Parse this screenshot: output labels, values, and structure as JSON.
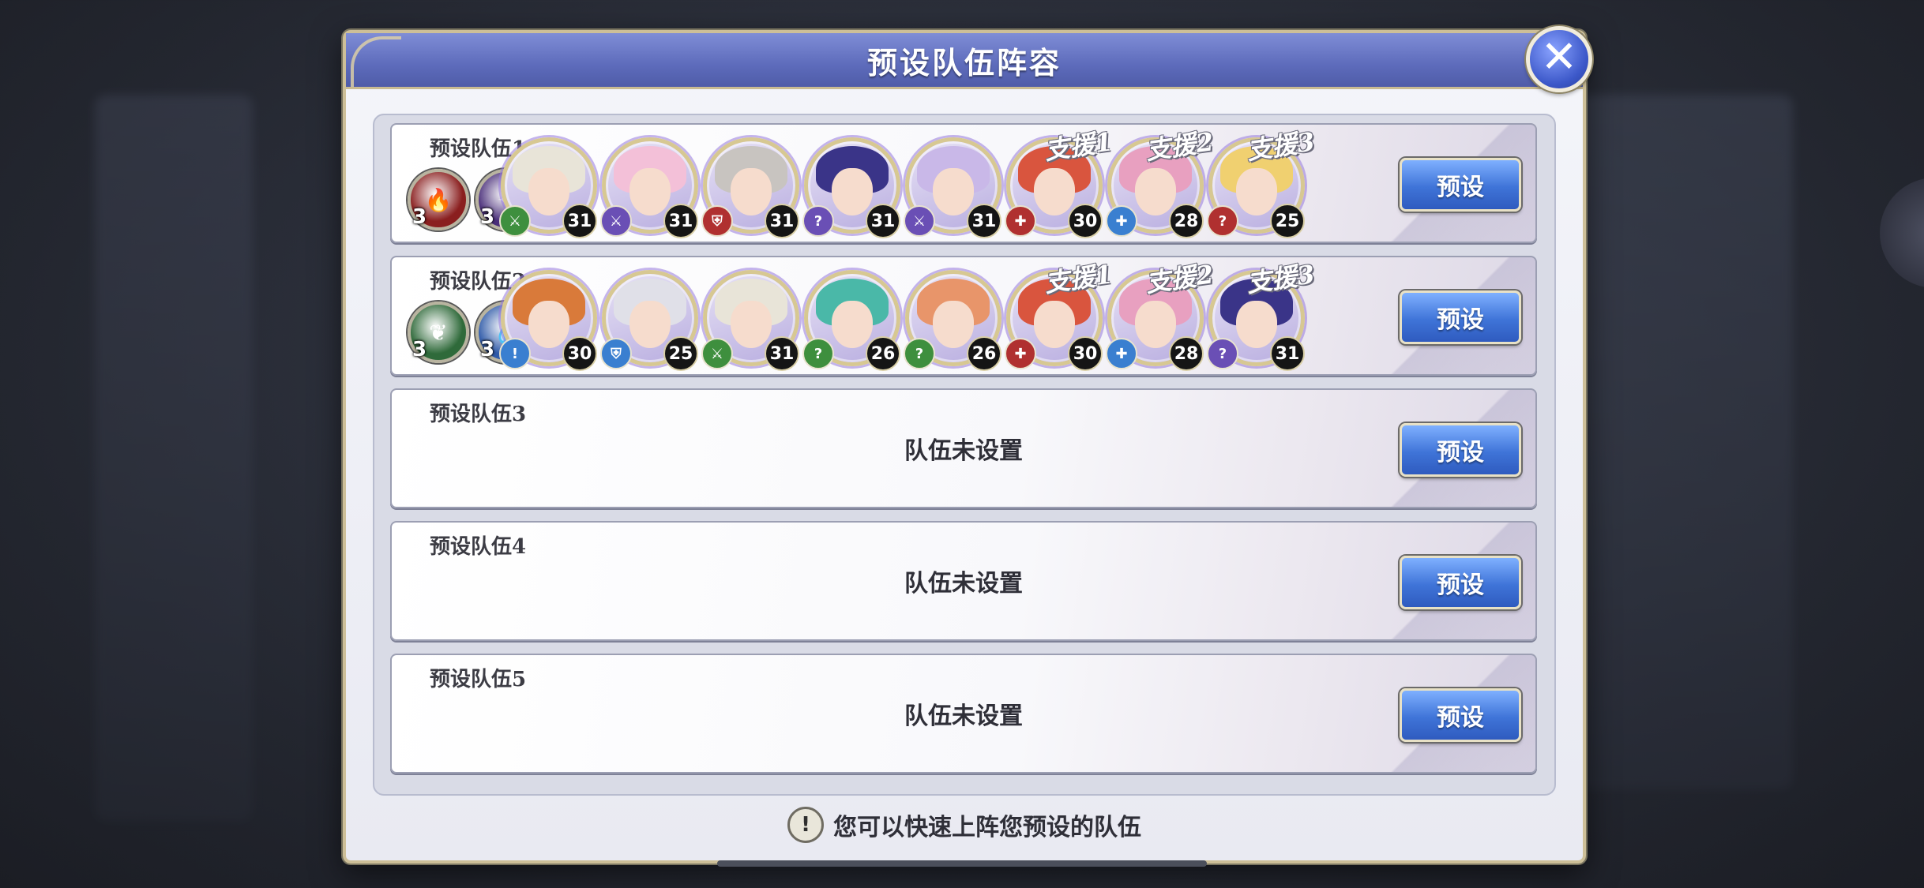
{
  "dialog": {
    "title": "预设队伍阵容",
    "tip": "您可以快速上阵您预设的队伍",
    "tip_icon": "!"
  },
  "close_icon": "✕",
  "colors": {
    "title_bar": "#5d6bbb",
    "button_blue": "#3f74d8",
    "frame_gold": "#cdbf98"
  },
  "teams": [
    {
      "label": "预设队伍1",
      "button": "预设",
      "elements": [
        {
          "icon": "fire-icon",
          "glyph": "🔥",
          "color": "#8a1f1f",
          "count": "3"
        },
        {
          "icon": "dark-icon",
          "glyph": "✦",
          "color": "#4a2f7a",
          "count": "3"
        }
      ],
      "members": [
        {
          "level": "31",
          "class": "sword",
          "class_glyph": "⚔",
          "class_color": "#3e8f3e",
          "hair": "#e8e4d8",
          "support": ""
        },
        {
          "level": "31",
          "class": "sword",
          "class_glyph": "⚔",
          "class_color": "#6a4fb5",
          "hair": "#f3c0d8",
          "support": ""
        },
        {
          "level": "31",
          "class": "shield",
          "class_glyph": "⛨",
          "class_color": "#b03030",
          "hair": "#c8c4c0",
          "support": ""
        },
        {
          "level": "31",
          "class": "mage",
          "class_glyph": "?",
          "class_color": "#6a4fb5",
          "hair": "#3a3488",
          "support": ""
        },
        {
          "level": "31",
          "class": "sword",
          "class_glyph": "⚔",
          "class_color": "#6a4fb5",
          "hair": "#c9b8e8",
          "support": ""
        },
        {
          "level": "30",
          "class": "healer",
          "class_glyph": "✚",
          "class_color": "#b03030",
          "hair": "#d9553e",
          "support": "支援1"
        },
        {
          "level": "28",
          "class": "healer",
          "class_glyph": "✚",
          "class_color": "#3a7fd0",
          "hair": "#e8a0c0",
          "support": "支援2"
        },
        {
          "level": "25",
          "class": "mage",
          "class_glyph": "?",
          "class_color": "#b03030",
          "hair": "#f0d070",
          "support": "支援3"
        }
      ]
    },
    {
      "label": "预设队伍2",
      "button": "预设",
      "elements": [
        {
          "icon": "wind-icon",
          "glyph": "❦",
          "color": "#2f6a3a",
          "count": "3"
        },
        {
          "icon": "water-icon",
          "glyph": "💧",
          "color": "#2f5aa8",
          "count": "3"
        }
      ],
      "members": [
        {
          "level": "30",
          "class": "lance",
          "class_glyph": "!",
          "class_color": "#3a7fd0",
          "hair": "#d97a3a",
          "support": ""
        },
        {
          "level": "25",
          "class": "shield",
          "class_glyph": "⛨",
          "class_color": "#3a7fd0",
          "hair": "#e0e0e8",
          "support": ""
        },
        {
          "level": "31",
          "class": "sword",
          "class_glyph": "⚔",
          "class_color": "#3e8f3e",
          "hair": "#e8e4d8",
          "support": ""
        },
        {
          "level": "26",
          "class": "mage",
          "class_glyph": "?",
          "class_color": "#3e8f3e",
          "hair": "#4ab8a8",
          "support": ""
        },
        {
          "level": "26",
          "class": "mage",
          "class_glyph": "?",
          "class_color": "#3e8f3e",
          "hair": "#e8956a",
          "support": ""
        },
        {
          "level": "30",
          "class": "healer",
          "class_glyph": "✚",
          "class_color": "#b03030",
          "hair": "#d9553e",
          "support": "支援1"
        },
        {
          "level": "28",
          "class": "healer",
          "class_glyph": "✚",
          "class_color": "#3a7fd0",
          "hair": "#e8a0c0",
          "support": "支援2"
        },
        {
          "level": "31",
          "class": "mage",
          "class_glyph": "?",
          "class_color": "#6a4fb5",
          "hair": "#3a3488",
          "support": "支援3"
        }
      ]
    },
    {
      "label": "预设队伍3",
      "button": "预设",
      "empty_text": "队伍未设置"
    },
    {
      "label": "预设队伍4",
      "button": "预设",
      "empty_text": "队伍未设置"
    },
    {
      "label": "预设队伍5",
      "button": "预设",
      "empty_text": "队伍未设置"
    }
  ]
}
